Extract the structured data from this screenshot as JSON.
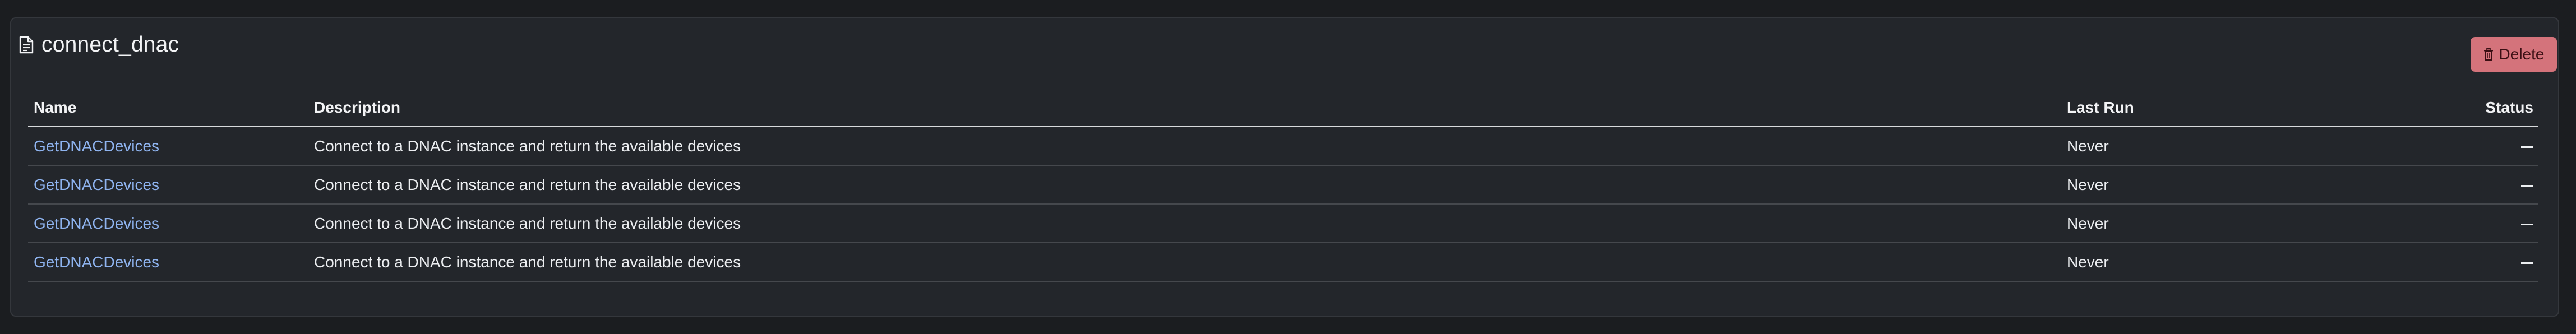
{
  "card": {
    "title": "connect_dnac",
    "delete_label": "Delete"
  },
  "table": {
    "columns": [
      "Name",
      "Description",
      "Last Run",
      "Status"
    ],
    "rows": [
      {
        "name": "GetDNACDevices",
        "description": "Connect to a DNAC instance and return the available devices",
        "last_run": "Never",
        "status": "—"
      },
      {
        "name": "GetDNACDevices",
        "description": "Connect to a DNAC instance and return the available devices",
        "last_run": "Never",
        "status": "—"
      },
      {
        "name": "GetDNACDevices",
        "description": "Connect to a DNAC instance and return the available devices",
        "last_run": "Never",
        "status": "—"
      },
      {
        "name": "GetDNACDevices",
        "description": "Connect to a DNAC instance and return the available devices",
        "last_run": "Never",
        "status": "—"
      }
    ]
  },
  "icons": {
    "title_icon": "file-icon",
    "delete_icon": "trash-icon"
  },
  "colors": {
    "background": "#1b1d20",
    "card": "#23262b",
    "link": "#8fb4f0",
    "delete_button": "#d4737b"
  }
}
